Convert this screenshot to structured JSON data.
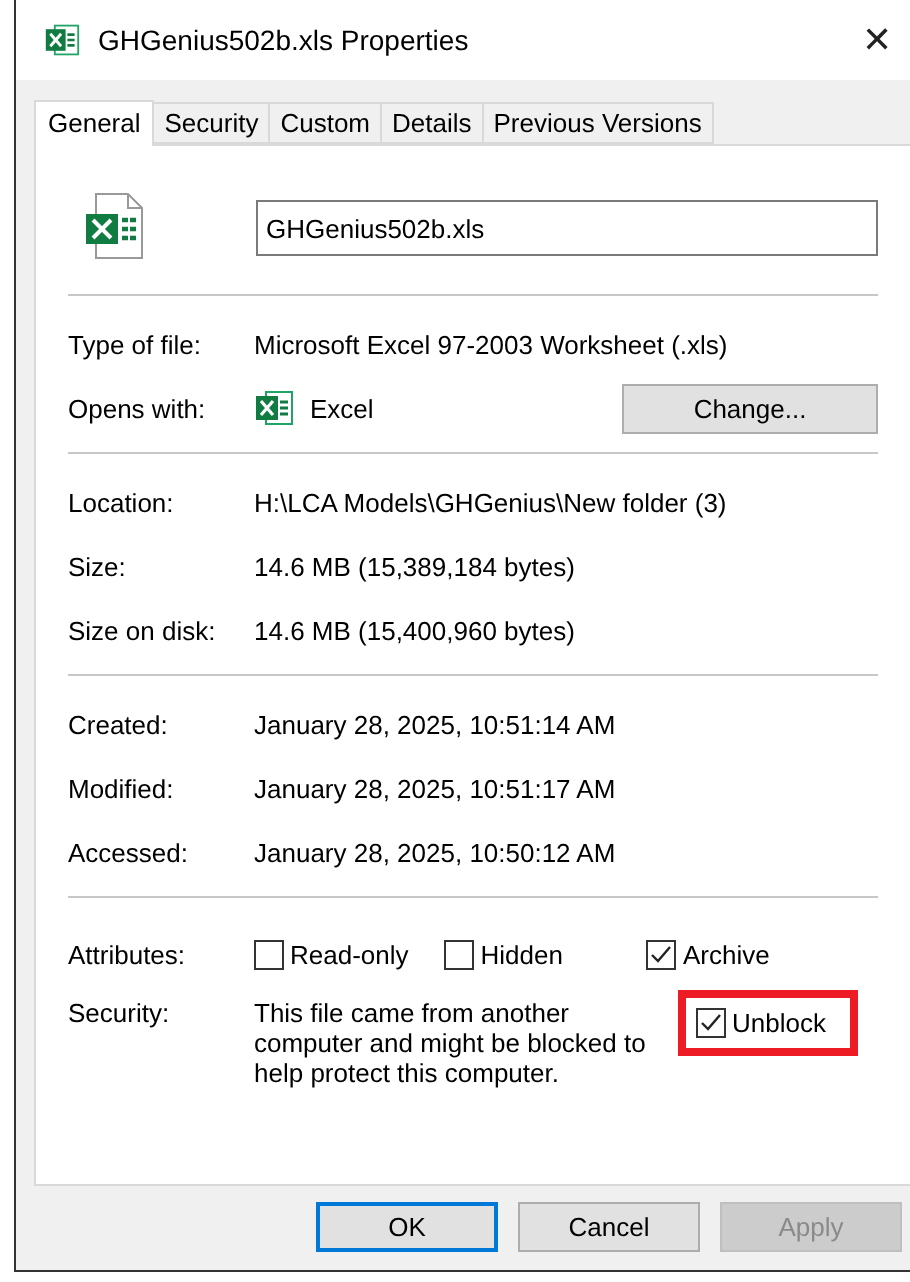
{
  "window": {
    "title": "GHGenius502b.xls Properties",
    "close": "✕"
  },
  "tabs": [
    {
      "label": "General",
      "selected": true
    },
    {
      "label": "Security",
      "selected": false
    },
    {
      "label": "Custom",
      "selected": false
    },
    {
      "label": "Details",
      "selected": false
    },
    {
      "label": "Previous Versions",
      "selected": false
    }
  ],
  "file_name": {
    "value": "GHGenius502b.xls"
  },
  "sections": [
    [
      {
        "label": "Type of file:",
        "value": "Microsoft Excel 97-2003 Worksheet (.xls)"
      },
      {
        "label": "Opens with:",
        "value": "Excel",
        "app_icon": true,
        "button": "Change..."
      }
    ],
    [
      {
        "label": "Location:",
        "value": "H:\\LCA Models\\GHGenius\\New folder (3)"
      },
      {
        "label": "Size:",
        "value": "14.6 MB (15,389,184 bytes)"
      },
      {
        "label": "Size on disk:",
        "value": "14.6 MB (15,400,960 bytes)"
      }
    ],
    [
      {
        "label": "Created:",
        "value": "January 28, 2025, 10:51:14 AM"
      },
      {
        "label": "Modified:",
        "value": "January 28, 2025, 10:51:17 AM"
      },
      {
        "label": "Accessed:",
        "value": "January 28, 2025, 10:50:12 AM"
      }
    ]
  ],
  "attributes": {
    "label": "Attributes:",
    "items": [
      {
        "label": "Read-only",
        "checked": false
      },
      {
        "label": "Hidden",
        "checked": false
      },
      {
        "label": "Archive",
        "checked": true
      }
    ]
  },
  "security": {
    "label": "Security:",
    "text": "This file came from another computer and might be blocked to help protect this computer.",
    "unblock": {
      "label": "Unblock",
      "checked": true,
      "highlighted": true
    }
  },
  "buttons": [
    {
      "label": "OK",
      "focused": true,
      "disabled": false
    },
    {
      "label": "Cancel",
      "focused": false,
      "disabled": false
    },
    {
      "label": "Apply",
      "focused": false,
      "disabled": true
    }
  ]
}
